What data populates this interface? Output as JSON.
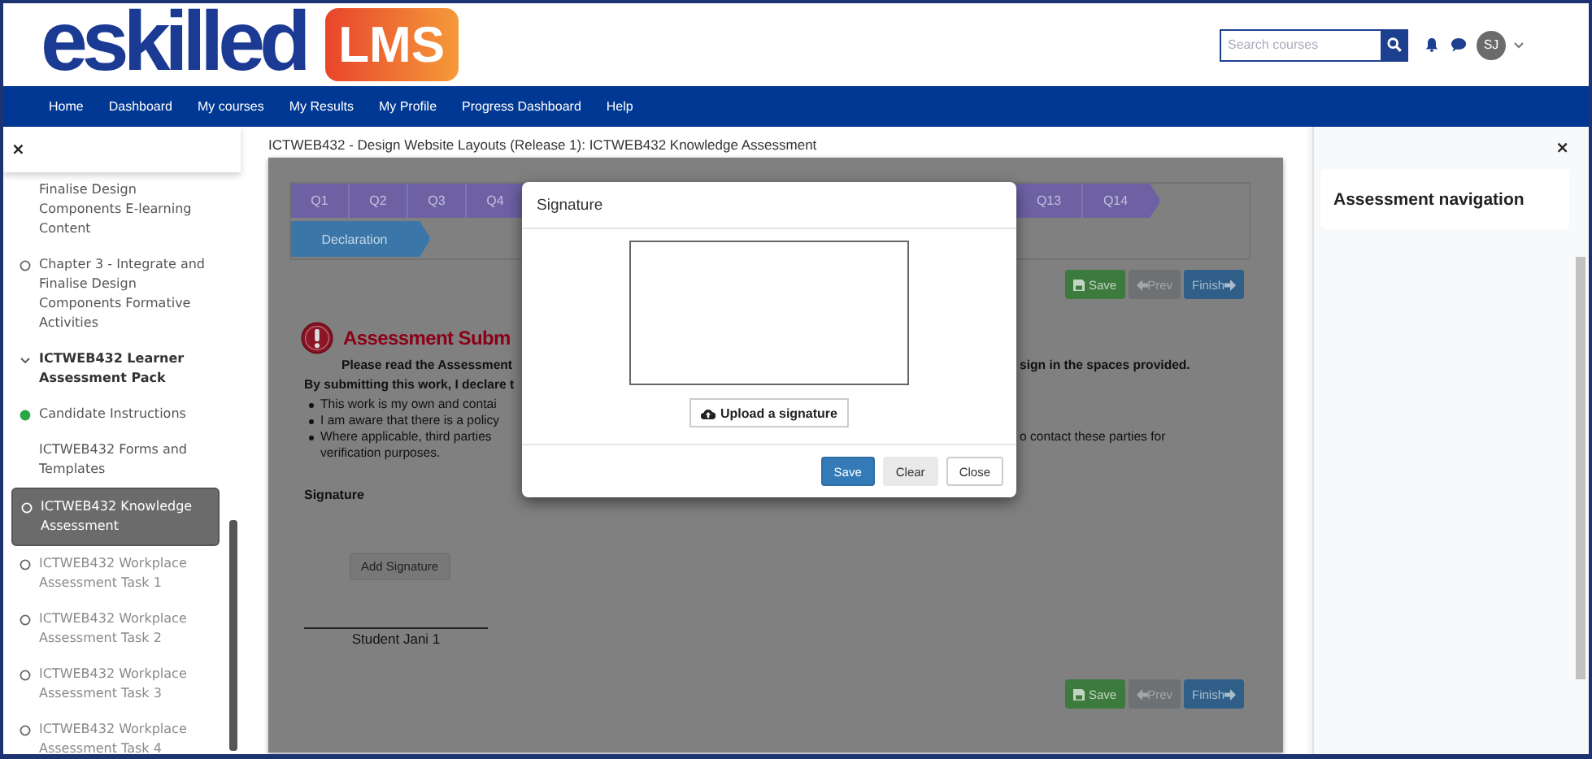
{
  "header": {
    "logo_text": "eskilled",
    "logo_badge": "LMS",
    "search": {
      "placeholder": "Search courses"
    },
    "user_initials": "SJ"
  },
  "nav": [
    "Home",
    "Dashboard",
    "My courses",
    "My Results",
    "My Profile",
    "Progress Dashboard",
    "Help"
  ],
  "sidebar": {
    "close": "×",
    "items": [
      {
        "kind": "activity",
        "label": "Finalise Design Components E-learning Content",
        "tracked": false,
        "selected": false,
        "disabled": false
      },
      {
        "kind": "activity",
        "label": "Chapter 3 - Integrate and Finalise Design Components Formative Activities",
        "tracked": true,
        "complete": false,
        "selected": false,
        "disabled": false
      },
      {
        "kind": "section",
        "label": "ICTWEB432 Learner Assessment Pack",
        "expanded": true,
        "selected": false,
        "disabled": false,
        "children": [
          {
            "kind": "activity",
            "label": "Candidate Instructions",
            "tracked": true,
            "complete": true,
            "selected": false,
            "disabled": false
          },
          {
            "kind": "activity",
            "label": "ICTWEB432 Forms and Templates",
            "tracked": false,
            "selected": false,
            "disabled": false
          },
          {
            "kind": "activity",
            "label": "ICTWEB432 Knowledge Assessment",
            "tracked": true,
            "complete": false,
            "selected": true,
            "disabled": false
          },
          {
            "kind": "activity",
            "label": "ICTWEB432 Workplace Assessment Task 1",
            "tracked": true,
            "complete": false,
            "selected": false,
            "disabled": true
          },
          {
            "kind": "activity",
            "label": "ICTWEB432 Workplace Assessment Task 2",
            "tracked": true,
            "complete": false,
            "selected": false,
            "disabled": true
          },
          {
            "kind": "activity",
            "label": "ICTWEB432 Workplace Assessment Task 3",
            "tracked": true,
            "complete": false,
            "selected": false,
            "disabled": true
          },
          {
            "kind": "activity",
            "label": "ICTWEB432 Workplace Assessment Task 4",
            "tracked": true,
            "complete": false,
            "selected": false,
            "disabled": true
          }
        ]
      }
    ]
  },
  "breadcrumb": "ICTWEB432 - Design Website Layouts (Release 1): ICTWEB432 Knowledge Assessment",
  "assessment": {
    "question_tabs_left": [
      {
        "label": "Q1",
        "selected": false
      },
      {
        "label": "Q2",
        "selected": false
      },
      {
        "label": "Q3",
        "selected": false
      },
      {
        "label": "Q4",
        "selected": false
      }
    ],
    "question_tabs_right": [
      {
        "label": "Q13",
        "selected": false
      },
      {
        "label": "Q14",
        "selected": false
      }
    ],
    "section_tabs": [
      {
        "label": "Declaration",
        "selected": true
      }
    ],
    "top_buttons": [
      {
        "kind": "save",
        "label": "Save"
      },
      {
        "kind": "prev",
        "label": "Prev"
      },
      {
        "kind": "finish",
        "label": "Finish"
      }
    ],
    "heading": "Assessment Subm",
    "paragraphs": [
      {
        "parts": [
          "Please read the Assessment",
          "sign in the spaces provided."
        ]
      },
      {
        "parts": [
          "By submitting this work, I declare t"
        ]
      }
    ],
    "bullets": [
      {
        "parts": [
          "This work is my own and contai"
        ]
      },
      {
        "parts": [
          "I am aware that there is a policy"
        ]
      },
      {
        "parts": [
          "Where applicable, third parties",
          "o contact these parties for"
        ],
        "continued": "verification purposes."
      }
    ],
    "signature_label": "Signature",
    "add_signature_button": "Add Signature",
    "signer": "Student Jani 1",
    "bottom_buttons": [
      {
        "kind": "save",
        "label": "Save"
      },
      {
        "kind": "prev",
        "label": "Prev"
      },
      {
        "kind": "finish",
        "label": "Finish"
      }
    ]
  },
  "modal": {
    "title": "Signature",
    "upload_button": "Upload a signature",
    "buttons": [
      {
        "kind": "primary",
        "label": "Save"
      },
      {
        "kind": "default",
        "label": "Clear"
      },
      {
        "kind": "outline",
        "label": "Close"
      }
    ]
  },
  "drawer": {
    "close": "×",
    "title": "Assessment navigation"
  }
}
